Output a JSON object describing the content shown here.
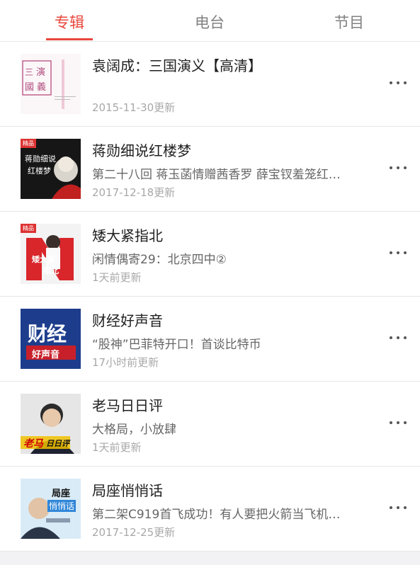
{
  "tabs": [
    {
      "label": "专辑",
      "active": true
    },
    {
      "label": "电台",
      "active": false
    },
    {
      "label": "节目",
      "active": false
    }
  ],
  "accent_color": "#e8473c",
  "albums": [
    {
      "title": "袁阔成：三国演义【高清】",
      "subtitle": "",
      "updated": "2015-11-30更新",
      "cover_text": [
        "三",
        "演",
        "國",
        "義"
      ]
    },
    {
      "title": "蒋勋细说红楼梦",
      "subtitle": "第二十八回 蒋玉菡情赠茜香罗 薛宝钗羞笼红…",
      "updated": "2017-12-18更新",
      "cover_text": [
        "精品",
        "蒋勋细说",
        "红楼梦"
      ]
    },
    {
      "title": "矮大紧指北",
      "subtitle": "闲情偶寄29：北京四中②",
      "updated": "1天前更新",
      "cover_text": [
        "精品",
        "矮大紧",
        "指北"
      ]
    },
    {
      "title": "财经好声音",
      "subtitle": "“股神”巴菲特开口！首谈比特币",
      "updated": "17小时前更新",
      "cover_text": [
        "财经",
        "好声音"
      ]
    },
    {
      "title": "老马日日评",
      "subtitle": "大格局，小放肆",
      "updated": "1天前更新",
      "cover_text": [
        "老马",
        "日日评"
      ]
    },
    {
      "title": "局座悄悄话",
      "subtitle": "第二架C919首飞成功！有人要把火箭当飞机…",
      "updated": "2017-12-25更新",
      "cover_text": [
        "局座",
        "悄悄话"
      ]
    }
  ]
}
